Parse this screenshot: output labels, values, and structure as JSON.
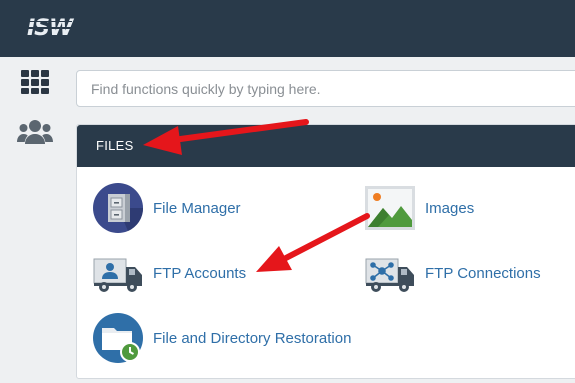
{
  "header": {
    "logo_text": "ISW"
  },
  "sidebar": {
    "items": [
      {
        "icon": "grid-icon",
        "label": ""
      },
      {
        "icon": "users-icon",
        "label": ""
      }
    ]
  },
  "search": {
    "placeholder": "Find functions quickly by typing here."
  },
  "files_panel": {
    "title": "FILES",
    "items": [
      {
        "label": "File Manager",
        "icon": "file-cabinet-icon"
      },
      {
        "label": "Images",
        "icon": "image-icon"
      },
      {
        "label": "FTP Accounts",
        "icon": "ftp-truck-user-icon"
      },
      {
        "label": "FTP Connections",
        "icon": "ftp-truck-network-icon"
      },
      {
        "label": "File and Directory Restoration",
        "icon": "folder-restore-icon"
      }
    ]
  },
  "annotations": {
    "arrow_color": "#e5161b"
  }
}
